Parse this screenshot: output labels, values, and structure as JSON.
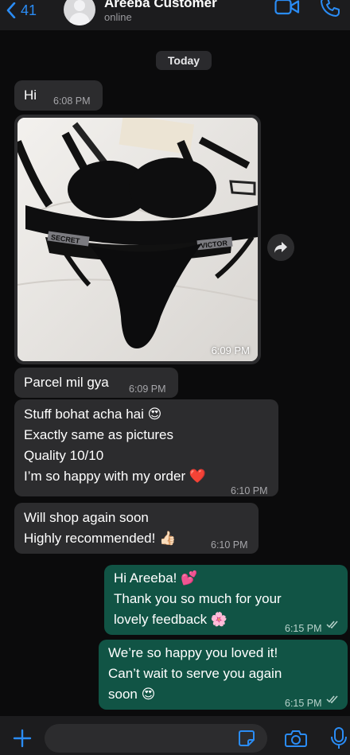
{
  "header": {
    "back_count": "41",
    "contact_name": "Areeba Customer",
    "status": "online",
    "accent": "#2a8cf5"
  },
  "chat": {
    "date_label": "Today",
    "messages": [
      {
        "dir": "in",
        "lines": [
          "Hi"
        ],
        "time": "6:08 PM"
      },
      {
        "dir": "in",
        "type": "image",
        "time": "6:09 PM"
      },
      {
        "dir": "in",
        "lines": [
          "Parcel mil gya"
        ],
        "time": "6:09 PM"
      },
      {
        "dir": "in",
        "lines": [
          "Stuff bohat acha hai 😍",
          "Exactly same as pictures",
          "Quality 10/10",
          "I’m so happy with my order ❤️"
        ],
        "time": "6:10 PM"
      },
      {
        "dir": "in",
        "lines": [
          "Will shop again soon",
          "Highly recommended! 👍🏻"
        ],
        "time": "6:10 PM"
      },
      {
        "dir": "out",
        "lines": [
          "Hi Areeba! 💕",
          "Thank you so much for your",
          "lovely feedback 🌸"
        ],
        "time": "6:15 PM",
        "status": "read"
      },
      {
        "dir": "out",
        "lines": [
          "We’re so happy you loved it!",
          "Can’t wait to serve you again",
          "soon 😍"
        ],
        "time": "6:15 PM",
        "status": "read"
      }
    ]
  },
  "photo": {
    "strap_text_left": "SECRET",
    "strap_text_right": "VICTOR"
  },
  "icons": {
    "back": "chevron-left-icon",
    "video": "video-call-icon",
    "phone": "phone-icon",
    "forward": "forward-icon",
    "plus": "plus-icon",
    "sticker": "sticker-icon",
    "camera": "camera-icon",
    "mic": "microphone-icon"
  },
  "colors": {
    "incoming_bubble": "#2c2c2e",
    "outgoing_bubble": "#115445",
    "background": "#0b0b0c"
  }
}
